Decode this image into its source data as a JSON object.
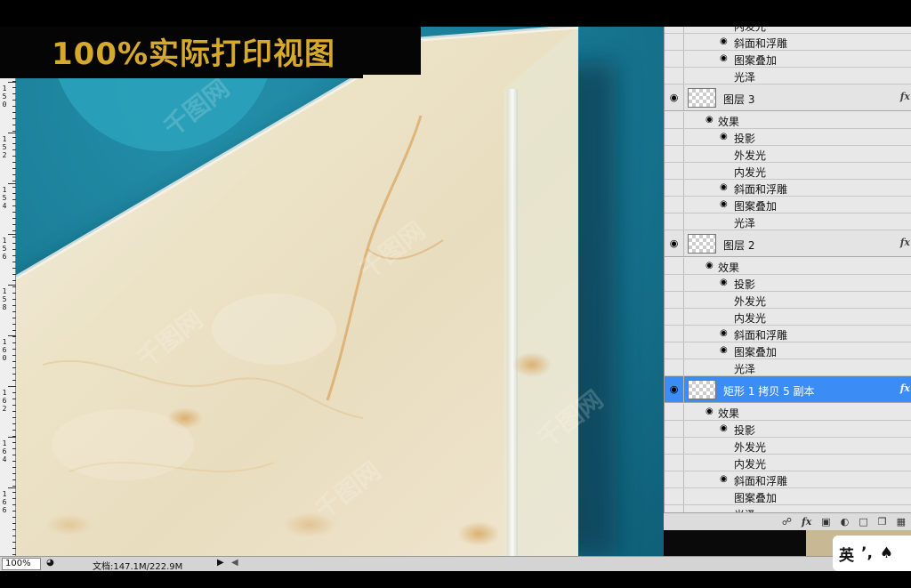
{
  "banner": {
    "title": "100%实际打印视图"
  },
  "ruler": {
    "labels": [
      {
        "digits": "150"
      },
      {
        "digits": "152"
      },
      {
        "digits": "154"
      },
      {
        "digits": "156"
      },
      {
        "digits": "158"
      },
      {
        "digits": "160"
      },
      {
        "digits": "162"
      },
      {
        "digits": "164"
      },
      {
        "digits": "166"
      }
    ]
  },
  "layers_panel": {
    "rows": [
      {
        "kind": "effect",
        "label": "内发光",
        "eye": false
      },
      {
        "kind": "effect",
        "label": "斜面和浮雕",
        "eye": true
      },
      {
        "kind": "effect",
        "label": "图案叠加",
        "eye": true
      },
      {
        "kind": "effect",
        "label": "光泽",
        "eye": false
      },
      {
        "kind": "layer",
        "label": "图层 3",
        "fx": "fx"
      },
      {
        "kind": "group",
        "label": "效果",
        "eye": true
      },
      {
        "kind": "effect",
        "label": "投影",
        "eye": true
      },
      {
        "kind": "effect",
        "label": "外发光",
        "eye": false
      },
      {
        "kind": "effect",
        "label": "内发光",
        "eye": false
      },
      {
        "kind": "effect",
        "label": "斜面和浮雕",
        "eye": true
      },
      {
        "kind": "effect",
        "label": "图案叠加",
        "eye": true
      },
      {
        "kind": "effect",
        "label": "光泽",
        "eye": false
      },
      {
        "kind": "layer",
        "label": "图层 2",
        "fx": "fx"
      },
      {
        "kind": "group",
        "label": "效果",
        "eye": true
      },
      {
        "kind": "effect",
        "label": "投影",
        "eye": true
      },
      {
        "kind": "effect",
        "label": "外发光",
        "eye": false
      },
      {
        "kind": "effect",
        "label": "内发光",
        "eye": false
      },
      {
        "kind": "effect",
        "label": "斜面和浮雕",
        "eye": true
      },
      {
        "kind": "effect",
        "label": "图案叠加",
        "eye": true
      },
      {
        "kind": "effect",
        "label": "光泽",
        "eye": false
      },
      {
        "kind": "layer",
        "label": "矩形 1 拷贝 5 副本",
        "fx": "fx",
        "selected": true
      },
      {
        "kind": "group",
        "label": "效果",
        "eye": true
      },
      {
        "kind": "effect",
        "label": "投影",
        "eye": true
      },
      {
        "kind": "effect",
        "label": "外发光",
        "eye": false
      },
      {
        "kind": "effect",
        "label": "内发光",
        "eye": false
      },
      {
        "kind": "effect",
        "label": "斜面和浮雕",
        "eye": true
      },
      {
        "kind": "effect",
        "label": "图案叠加",
        "eye": false
      },
      {
        "kind": "effect",
        "label": "光泽",
        "eye": false
      }
    ],
    "toolbar_icons": [
      "link-icon",
      "fx-icon",
      "mask-icon",
      "adjustment-icon",
      "folder-icon",
      "new-layer-icon",
      "trash-icon"
    ]
  },
  "status_bar": {
    "zoom": "100%",
    "doc_size": "文档:147.1M/222.9M"
  },
  "ime": {
    "lang": "英",
    "punct": "’,",
    "icon": "shirt-icon"
  },
  "watermark": {
    "text": "千图网"
  },
  "colors": {
    "canvas_bg": "#1a7d99",
    "selection": "#3b8df5",
    "banner_text": "#d6a92c"
  }
}
